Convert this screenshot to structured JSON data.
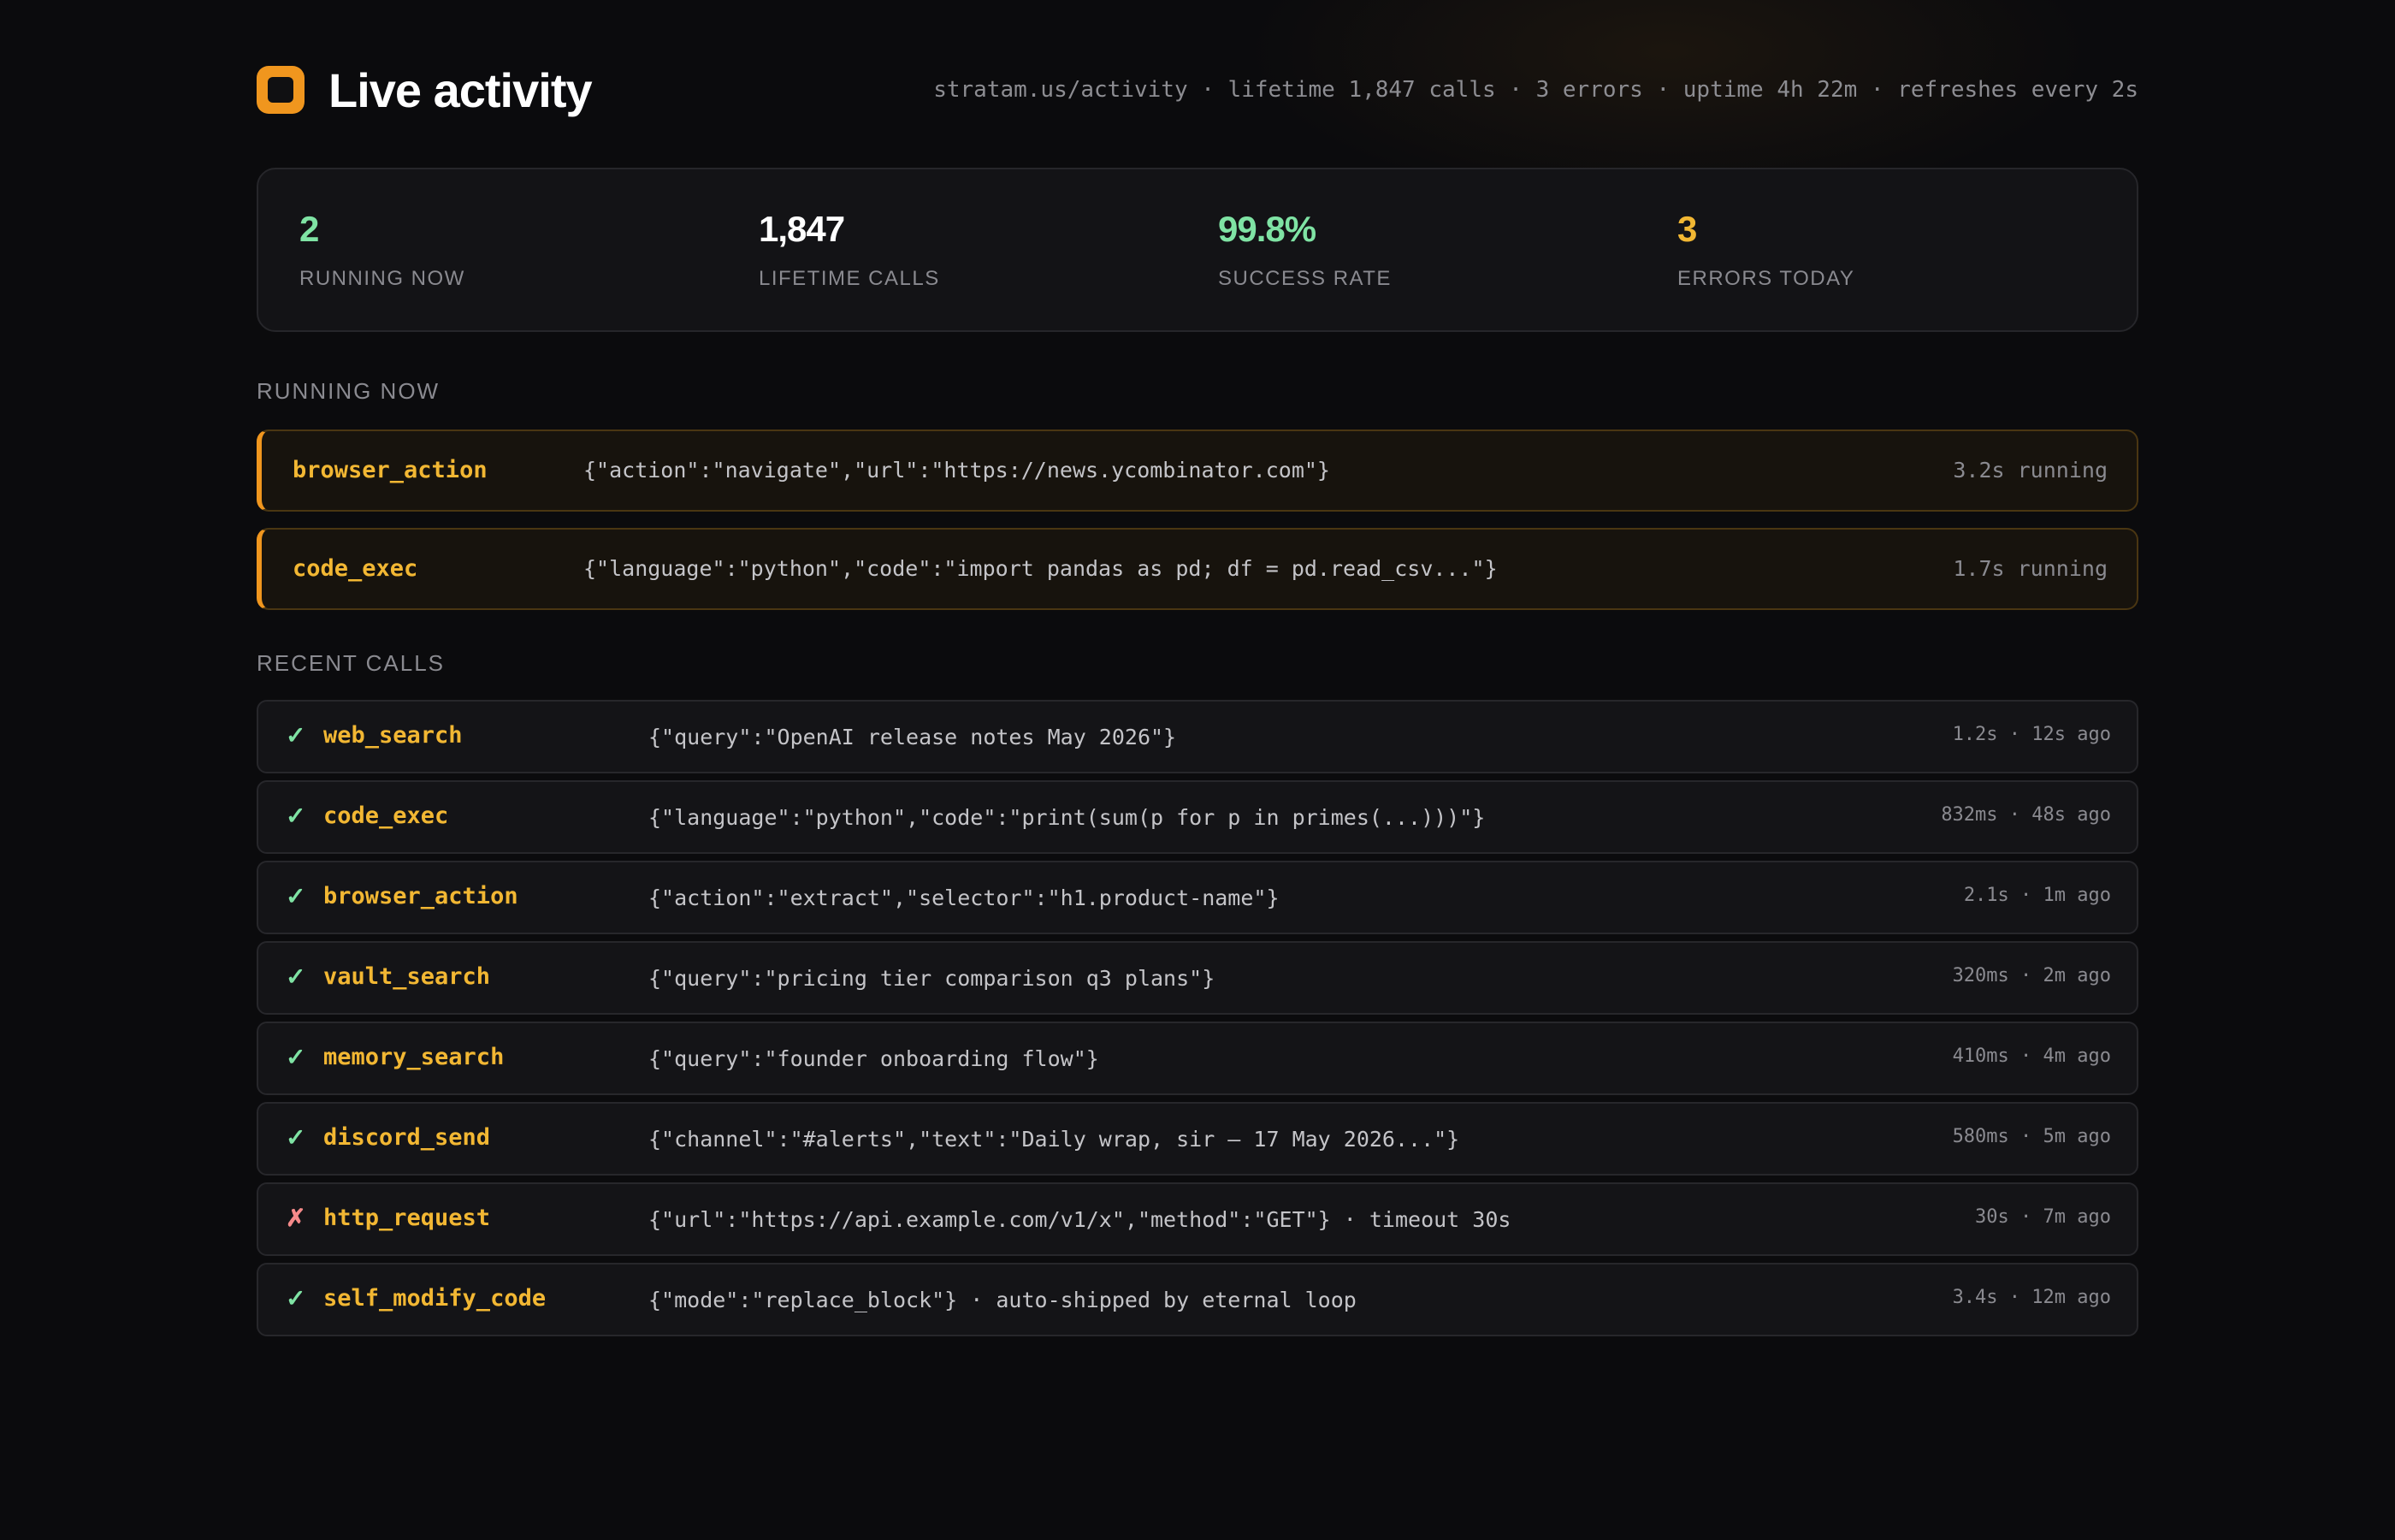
{
  "header": {
    "title": "Live activity",
    "meta": "stratam.us/activity · lifetime 1,847 calls · 3 errors · uptime 4h 22m · refreshes every 2s",
    "logo_icon": "square-logo-icon"
  },
  "colors": {
    "accent": "#f0961e",
    "tool_name": "#f2b733",
    "success": "#7fe3a4",
    "error": "#f58a8a",
    "white": "#ffffff"
  },
  "stats": [
    {
      "value": "2",
      "label": "RUNNING NOW",
      "color": "#7fe3a4"
    },
    {
      "value": "1,847",
      "label": "LIFETIME CALLS",
      "color": "#ffffff"
    },
    {
      "value": "99.8%",
      "label": "SUCCESS RATE",
      "color": "#7fe3a4"
    },
    {
      "value": "3",
      "label": "ERRORS TODAY",
      "color": "#f2b733"
    }
  ],
  "running": {
    "title": "RUNNING NOW",
    "items": [
      {
        "tool": "browser_action",
        "args": "{\"action\":\"navigate\",\"url\":\"https://news.ycombinator.com\"}",
        "timing": "3.2s running"
      },
      {
        "tool": "code_exec",
        "args": "{\"language\":\"python\",\"code\":\"import pandas as pd; df = pd.read_csv...\"}",
        "timing": "1.7s running"
      }
    ]
  },
  "recent": {
    "title": "RECENT CALLS",
    "items": [
      {
        "status": "✓",
        "status_type": "ok",
        "tool": "web_search",
        "args": "{\"query\":\"OpenAI release notes May 2026\"}",
        "timing": "1.2s · 12s ago"
      },
      {
        "status": "✓",
        "status_type": "ok",
        "tool": "code_exec",
        "args": "{\"language\":\"python\",\"code\":\"print(sum(p for p in primes(...)))\"}",
        "timing": "832ms · 48s ago"
      },
      {
        "status": "✓",
        "status_type": "ok",
        "tool": "browser_action",
        "args": "{\"action\":\"extract\",\"selector\":\"h1.product-name\"}",
        "timing": "2.1s · 1m ago"
      },
      {
        "status": "✓",
        "status_type": "ok",
        "tool": "vault_search",
        "args": "{\"query\":\"pricing tier comparison q3 plans\"}",
        "timing": "320ms · 2m ago"
      },
      {
        "status": "✓",
        "status_type": "ok",
        "tool": "memory_search",
        "args": "{\"query\":\"founder onboarding flow\"}",
        "timing": "410ms · 4m ago"
      },
      {
        "status": "✓",
        "status_type": "ok",
        "tool": "discord_send",
        "args": "{\"channel\":\"#alerts\",\"text\":\"Daily wrap, sir — 17 May 2026...\"}",
        "timing": "580ms · 5m ago"
      },
      {
        "status": "✗",
        "status_type": "err",
        "tool": "http_request",
        "args": "{\"url\":\"https://api.example.com/v1/x\",\"method\":\"GET\"} · timeout 30s",
        "timing": "30s · 7m ago"
      },
      {
        "status": "✓",
        "status_type": "ok",
        "tool": "self_modify_code",
        "args": "{\"mode\":\"replace_block\"} · auto-shipped by eternal loop",
        "timing": "3.4s · 12m ago"
      }
    ]
  }
}
